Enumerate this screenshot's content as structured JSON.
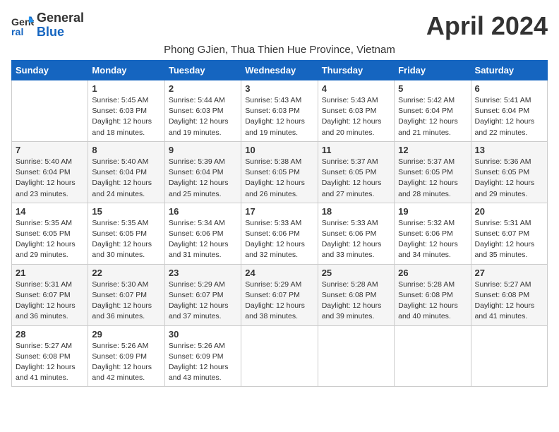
{
  "logo": {
    "line1": "General",
    "line2": "Blue"
  },
  "title": "April 2024",
  "subtitle": "Phong GJien, Thua Thien Hue Province, Vietnam",
  "days_of_week": [
    "Sunday",
    "Monday",
    "Tuesday",
    "Wednesday",
    "Thursday",
    "Friday",
    "Saturday"
  ],
  "weeks": [
    [
      {
        "day": "",
        "info": ""
      },
      {
        "day": "1",
        "info": "Sunrise: 5:45 AM\nSunset: 6:03 PM\nDaylight: 12 hours\nand 18 minutes."
      },
      {
        "day": "2",
        "info": "Sunrise: 5:44 AM\nSunset: 6:03 PM\nDaylight: 12 hours\nand 19 minutes."
      },
      {
        "day": "3",
        "info": "Sunrise: 5:43 AM\nSunset: 6:03 PM\nDaylight: 12 hours\nand 19 minutes."
      },
      {
        "day": "4",
        "info": "Sunrise: 5:43 AM\nSunset: 6:03 PM\nDaylight: 12 hours\nand 20 minutes."
      },
      {
        "day": "5",
        "info": "Sunrise: 5:42 AM\nSunset: 6:04 PM\nDaylight: 12 hours\nand 21 minutes."
      },
      {
        "day": "6",
        "info": "Sunrise: 5:41 AM\nSunset: 6:04 PM\nDaylight: 12 hours\nand 22 minutes."
      }
    ],
    [
      {
        "day": "7",
        "info": "Sunrise: 5:40 AM\nSunset: 6:04 PM\nDaylight: 12 hours\nand 23 minutes."
      },
      {
        "day": "8",
        "info": "Sunrise: 5:40 AM\nSunset: 6:04 PM\nDaylight: 12 hours\nand 24 minutes."
      },
      {
        "day": "9",
        "info": "Sunrise: 5:39 AM\nSunset: 6:04 PM\nDaylight: 12 hours\nand 25 minutes."
      },
      {
        "day": "10",
        "info": "Sunrise: 5:38 AM\nSunset: 6:05 PM\nDaylight: 12 hours\nand 26 minutes."
      },
      {
        "day": "11",
        "info": "Sunrise: 5:37 AM\nSunset: 6:05 PM\nDaylight: 12 hours\nand 27 minutes."
      },
      {
        "day": "12",
        "info": "Sunrise: 5:37 AM\nSunset: 6:05 PM\nDaylight: 12 hours\nand 28 minutes."
      },
      {
        "day": "13",
        "info": "Sunrise: 5:36 AM\nSunset: 6:05 PM\nDaylight: 12 hours\nand 29 minutes."
      }
    ],
    [
      {
        "day": "14",
        "info": "Sunrise: 5:35 AM\nSunset: 6:05 PM\nDaylight: 12 hours\nand 29 minutes."
      },
      {
        "day": "15",
        "info": "Sunrise: 5:35 AM\nSunset: 6:05 PM\nDaylight: 12 hours\nand 30 minutes."
      },
      {
        "day": "16",
        "info": "Sunrise: 5:34 AM\nSunset: 6:06 PM\nDaylight: 12 hours\nand 31 minutes."
      },
      {
        "day": "17",
        "info": "Sunrise: 5:33 AM\nSunset: 6:06 PM\nDaylight: 12 hours\nand 32 minutes."
      },
      {
        "day": "18",
        "info": "Sunrise: 5:33 AM\nSunset: 6:06 PM\nDaylight: 12 hours\nand 33 minutes."
      },
      {
        "day": "19",
        "info": "Sunrise: 5:32 AM\nSunset: 6:06 PM\nDaylight: 12 hours\nand 34 minutes."
      },
      {
        "day": "20",
        "info": "Sunrise: 5:31 AM\nSunset: 6:07 PM\nDaylight: 12 hours\nand 35 minutes."
      }
    ],
    [
      {
        "day": "21",
        "info": "Sunrise: 5:31 AM\nSunset: 6:07 PM\nDaylight: 12 hours\nand 36 minutes."
      },
      {
        "day": "22",
        "info": "Sunrise: 5:30 AM\nSunset: 6:07 PM\nDaylight: 12 hours\nand 36 minutes."
      },
      {
        "day": "23",
        "info": "Sunrise: 5:29 AM\nSunset: 6:07 PM\nDaylight: 12 hours\nand 37 minutes."
      },
      {
        "day": "24",
        "info": "Sunrise: 5:29 AM\nSunset: 6:07 PM\nDaylight: 12 hours\nand 38 minutes."
      },
      {
        "day": "25",
        "info": "Sunrise: 5:28 AM\nSunset: 6:08 PM\nDaylight: 12 hours\nand 39 minutes."
      },
      {
        "day": "26",
        "info": "Sunrise: 5:28 AM\nSunset: 6:08 PM\nDaylight: 12 hours\nand 40 minutes."
      },
      {
        "day": "27",
        "info": "Sunrise: 5:27 AM\nSunset: 6:08 PM\nDaylight: 12 hours\nand 41 minutes."
      }
    ],
    [
      {
        "day": "28",
        "info": "Sunrise: 5:27 AM\nSunset: 6:08 PM\nDaylight: 12 hours\nand 41 minutes."
      },
      {
        "day": "29",
        "info": "Sunrise: 5:26 AM\nSunset: 6:09 PM\nDaylight: 12 hours\nand 42 minutes."
      },
      {
        "day": "30",
        "info": "Sunrise: 5:26 AM\nSunset: 6:09 PM\nDaylight: 12 hours\nand 43 minutes."
      },
      {
        "day": "",
        "info": ""
      },
      {
        "day": "",
        "info": ""
      },
      {
        "day": "",
        "info": ""
      },
      {
        "day": "",
        "info": ""
      }
    ]
  ]
}
